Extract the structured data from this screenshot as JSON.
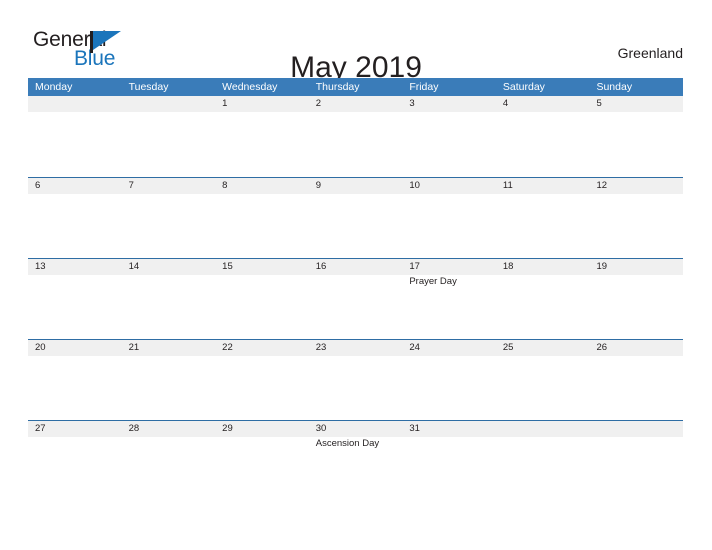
{
  "brand": {
    "name_part1": "General",
    "name_part2": "Blue",
    "flag_icon": "triangle-flag-icon",
    "accent_color": "#1b75bb"
  },
  "header": {
    "title": "May 2019",
    "location": "Greenland"
  },
  "colors": {
    "header_blue": "#3a7cb9",
    "row_divider_blue": "#2e6da4",
    "date_band_gray": "#f0f0f0",
    "text": "#231f20"
  },
  "calendar": {
    "month": "May",
    "year": "2019",
    "weekday_headers": [
      "Monday",
      "Tuesday",
      "Wednesday",
      "Thursday",
      "Friday",
      "Saturday",
      "Sunday"
    ],
    "weeks": [
      [
        {
          "date": "",
          "event": ""
        },
        {
          "date": "",
          "event": ""
        },
        {
          "date": "1",
          "event": ""
        },
        {
          "date": "2",
          "event": ""
        },
        {
          "date": "3",
          "event": ""
        },
        {
          "date": "4",
          "event": ""
        },
        {
          "date": "5",
          "event": ""
        }
      ],
      [
        {
          "date": "6",
          "event": ""
        },
        {
          "date": "7",
          "event": ""
        },
        {
          "date": "8",
          "event": ""
        },
        {
          "date": "9",
          "event": ""
        },
        {
          "date": "10",
          "event": ""
        },
        {
          "date": "11",
          "event": ""
        },
        {
          "date": "12",
          "event": ""
        }
      ],
      [
        {
          "date": "13",
          "event": ""
        },
        {
          "date": "14",
          "event": ""
        },
        {
          "date": "15",
          "event": ""
        },
        {
          "date": "16",
          "event": ""
        },
        {
          "date": "17",
          "event": "Prayer Day"
        },
        {
          "date": "18",
          "event": ""
        },
        {
          "date": "19",
          "event": ""
        }
      ],
      [
        {
          "date": "20",
          "event": ""
        },
        {
          "date": "21",
          "event": ""
        },
        {
          "date": "22",
          "event": ""
        },
        {
          "date": "23",
          "event": ""
        },
        {
          "date": "24",
          "event": ""
        },
        {
          "date": "25",
          "event": ""
        },
        {
          "date": "26",
          "event": ""
        }
      ],
      [
        {
          "date": "27",
          "event": ""
        },
        {
          "date": "28",
          "event": ""
        },
        {
          "date": "29",
          "event": ""
        },
        {
          "date": "30",
          "event": "Ascension Day"
        },
        {
          "date": "31",
          "event": ""
        },
        {
          "date": "",
          "event": ""
        },
        {
          "date": "",
          "event": ""
        }
      ]
    ]
  }
}
